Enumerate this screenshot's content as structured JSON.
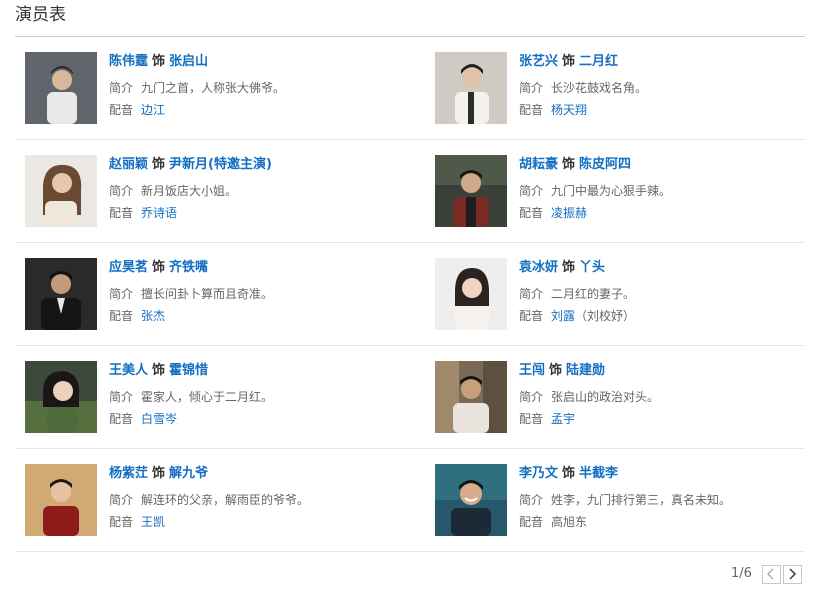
{
  "section": {
    "title": "演员表"
  },
  "cast": [
    {
      "actor": "陈伟霆",
      "as": "饰",
      "role": "张启山",
      "intro_label": "简介",
      "intro": "九门之首，人称张大佛爷。",
      "voice_label": "配音",
      "voice": "边江"
    },
    {
      "actor": "张艺兴",
      "as": "饰",
      "role": "二月红",
      "intro_label": "简介",
      "intro": "长沙花鼓戏名角。",
      "voice_label": "配音",
      "voice": "杨天翔"
    },
    {
      "actor": "赵丽颖",
      "as": "饰",
      "role": "尹新月(特邀主演)",
      "intro_label": "简介",
      "intro": "新月饭店大小姐。",
      "voice_label": "配音",
      "voice": "乔诗语"
    },
    {
      "actor": "胡耘豪",
      "as": "饰",
      "role": "陈皮阿四",
      "intro_label": "简介",
      "intro": "九门中最为心狠手辣。",
      "voice_label": "配音",
      "voice": "凌振赫"
    },
    {
      "actor": "应昊茗",
      "as": "饰",
      "role": "齐铁嘴",
      "intro_label": "简介",
      "intro": "擅长问卦卜算而且奇准。",
      "voice_label": "配音",
      "voice": "张杰"
    },
    {
      "actor": "袁冰妍",
      "as": "饰",
      "role": "丫头",
      "intro_label": "简介",
      "intro": "二月红的妻子。",
      "voice_label": "配音",
      "voice": "刘露",
      "voice_extra": "（刘校妤）"
    },
    {
      "actor": "王美人",
      "as": "饰",
      "role": "霍锦惜",
      "intro_label": "简介",
      "intro": "霍家人，倾心于二月红。",
      "voice_label": "配音",
      "voice": "白雪岑"
    },
    {
      "actor": "王闯",
      "as": "饰",
      "role": "陆建勋",
      "intro_label": "简介",
      "intro": "张启山的政治对头。",
      "voice_label": "配音",
      "voice": "孟宇"
    },
    {
      "actor": "杨紫茳",
      "as": "饰",
      "role": "解九爷",
      "intro_label": "简介",
      "intro": "解连环的父亲，解雨臣的爷爷。",
      "voice_label": "配音",
      "voice": "王凯"
    },
    {
      "actor": "李乃文",
      "as": "饰",
      "role": "半截李",
      "intro_label": "简介",
      "intro": "姓李，九门排行第三，真名未知。",
      "voice_label": "配音",
      "voice": "高旭东"
    }
  ],
  "pagination": {
    "text": "1/6",
    "prev_icon": "chevron-left-icon",
    "next_icon": "chevron-right-icon"
  },
  "colors": {
    "link": "#136ec2",
    "text": "#333333",
    "muted": "#666666",
    "rule": "#c9c9c9",
    "divider": "#e6e6e6"
  }
}
